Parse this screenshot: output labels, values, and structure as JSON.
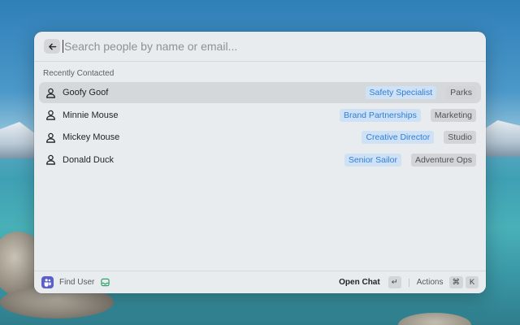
{
  "search": {
    "back_icon": "arrow-left-icon",
    "placeholder": "Search people by name or email..."
  },
  "section": {
    "title": "Recently Contacted"
  },
  "people": [
    {
      "name": "Goofy Goof",
      "role": "Safety Specialist",
      "department": "Parks",
      "selected": true
    },
    {
      "name": "Minnie Mouse",
      "role": "Brand Partnerships",
      "department": "Marketing",
      "selected": false
    },
    {
      "name": "Mickey Mouse",
      "role": "Creative Director",
      "department": "Studio",
      "selected": false
    },
    {
      "name": "Donald Duck",
      "role": "Senior Sailor",
      "department": "Adventure Ops",
      "selected": false
    }
  ],
  "footer": {
    "app_icon": "teams-icon",
    "command_label": "Find User",
    "tray_icon": "inbox-tray-icon",
    "primary_action": "Open Chat",
    "primary_key": "↵",
    "secondary_action": "Actions",
    "secondary_keys": [
      "⌘",
      "K"
    ]
  },
  "colors": {
    "panel_bg": "#e9ecef",
    "selected_row": "#d5d8db",
    "role_tag_bg": "#cfe1f5",
    "role_tag_text": "#2f7ed8",
    "department_tag_bg": "#d2d4d6",
    "app_icon_bg": "#5b5fc7",
    "tray_icon": "#2fa36b"
  }
}
